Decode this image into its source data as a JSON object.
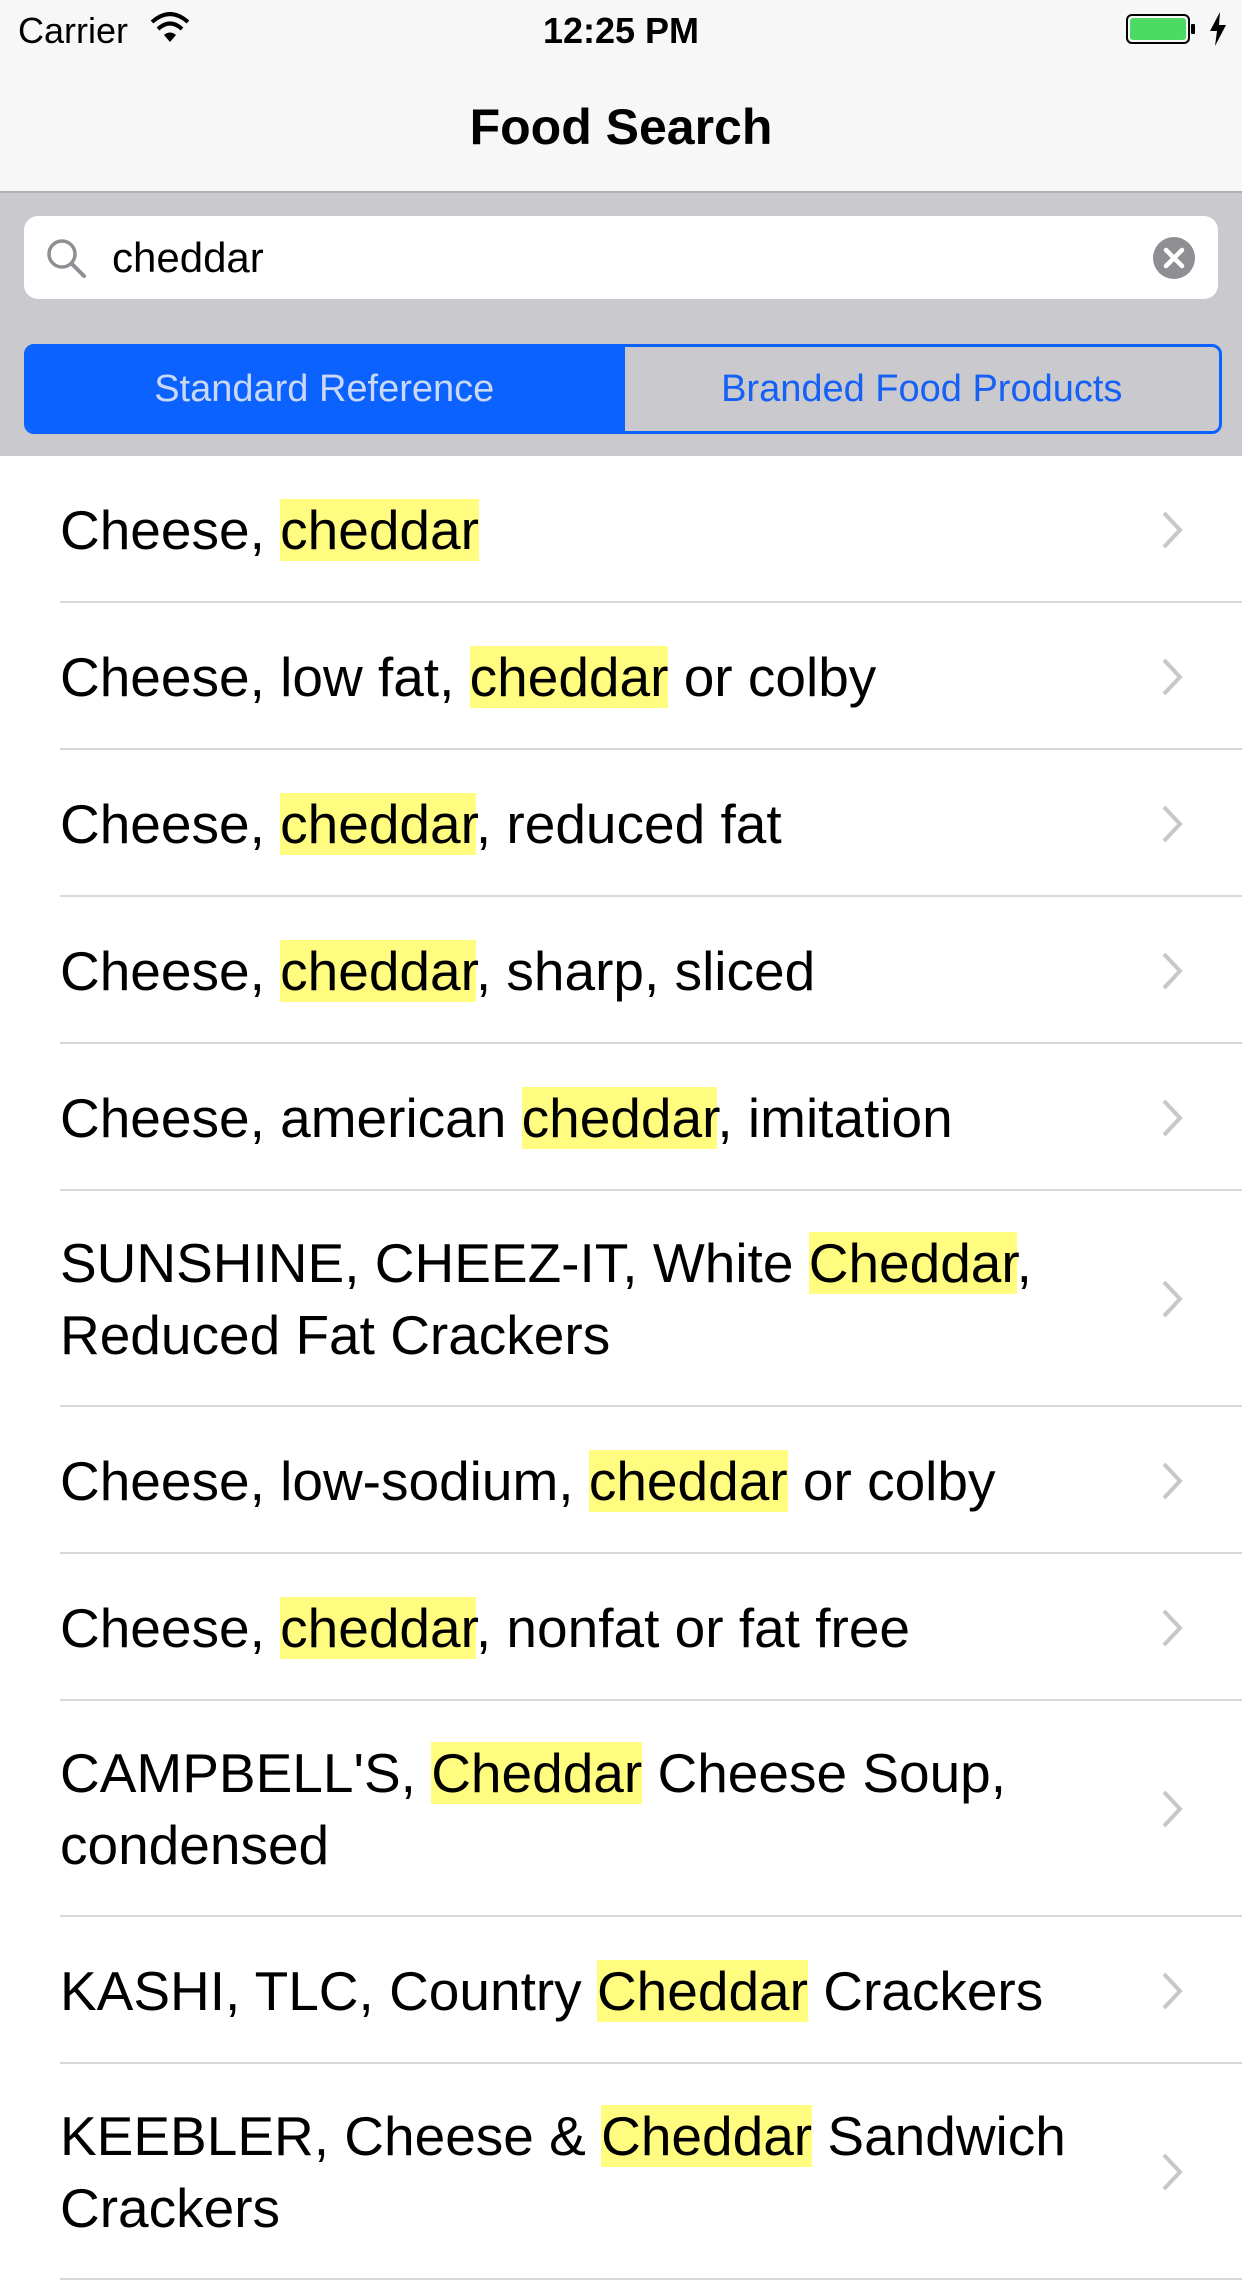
{
  "status_bar": {
    "carrier": "Carrier",
    "time": "12:25 PM",
    "battery_color": "#4cd964"
  },
  "nav": {
    "title": "Food Search"
  },
  "search": {
    "value": "cheddar",
    "placeholder": "Search"
  },
  "segments": [
    {
      "label": "Standard Reference",
      "selected": true
    },
    {
      "label": "Branded Food Products",
      "selected": false
    }
  ],
  "colors": {
    "accent": "#0c62ff",
    "highlight": "#fffc80"
  },
  "results": [
    {
      "before": "Cheese, ",
      "match": "cheddar",
      "after": ""
    },
    {
      "before": "Cheese, low fat, ",
      "match": "cheddar",
      "after": " or colby"
    },
    {
      "before": "Cheese, ",
      "match": "cheddar",
      "after": ", reduced fat"
    },
    {
      "before": "Cheese, ",
      "match": "cheddar",
      "after": ", sharp, sliced"
    },
    {
      "before": "Cheese, american ",
      "match": "cheddar",
      "after": ", imitation"
    },
    {
      "before": "SUNSHINE, CHEEZ-IT, White ",
      "match": "Cheddar",
      "after": ", Reduced Fat Crackers"
    },
    {
      "before": "Cheese, low-sodium, ",
      "match": "cheddar",
      "after": " or colby"
    },
    {
      "before": "Cheese, ",
      "match": "cheddar",
      "after": ", nonfat or fat free"
    },
    {
      "before": "CAMPBELL'S, ",
      "match": "Cheddar",
      "after": " Cheese Soup, condensed"
    },
    {
      "before": "KASHI, TLC, Country ",
      "match": "Cheddar",
      "after": " Crackers"
    },
    {
      "before": "KEEBLER, Cheese & ",
      "match": "Cheddar",
      "after": " Sandwich Crackers"
    }
  ]
}
